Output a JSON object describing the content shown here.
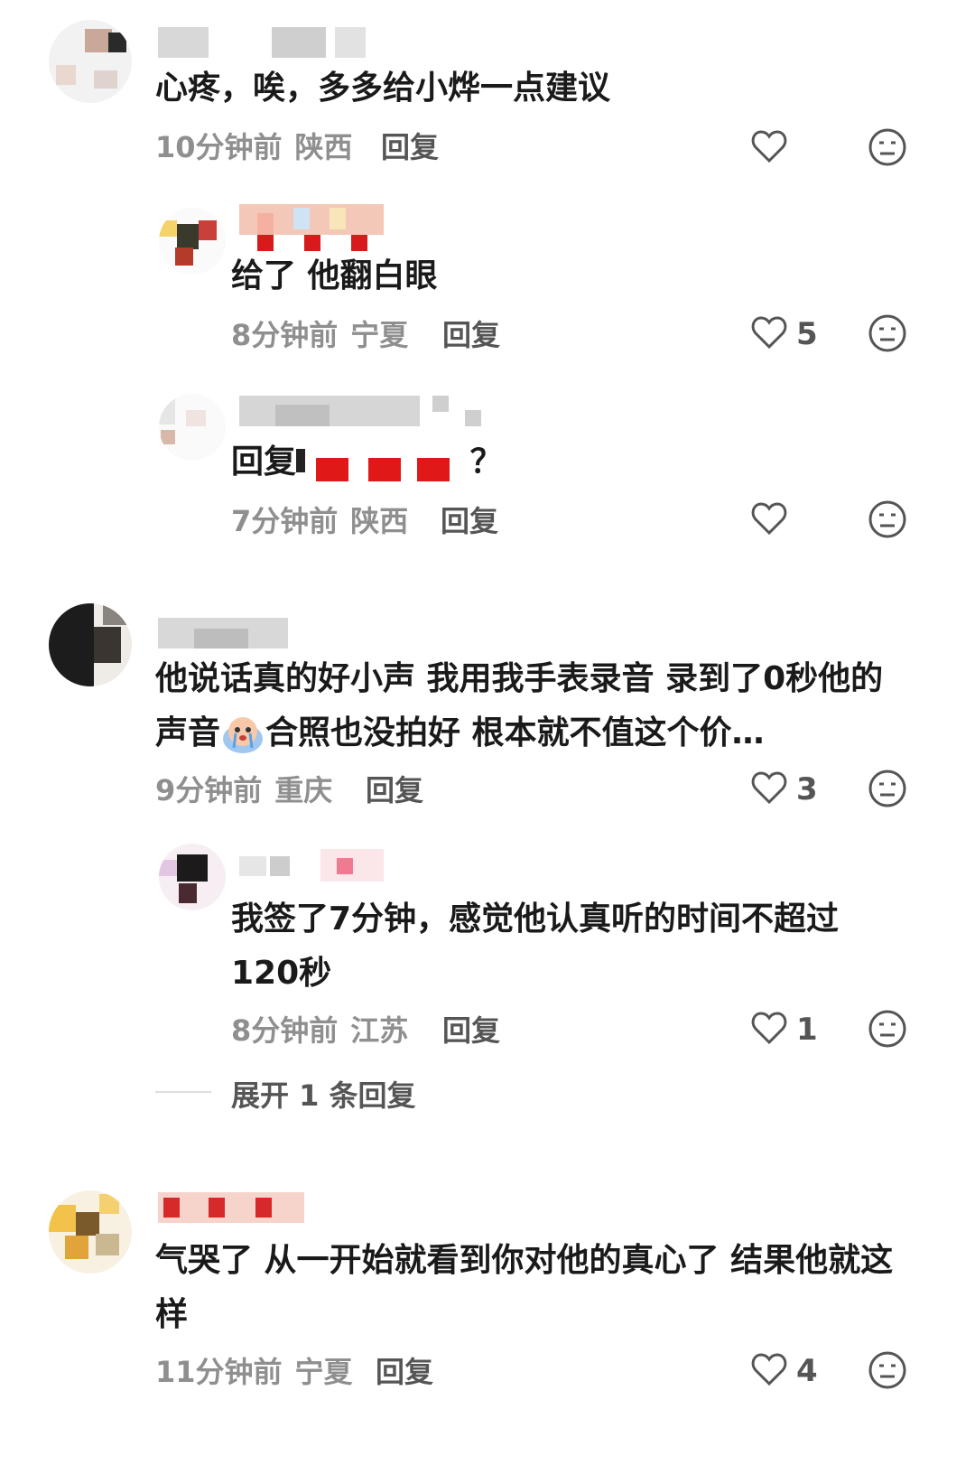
{
  "comments": [
    {
      "text": "心疼，唉，多多给小烨一点建议",
      "time": "10分钟前",
      "location": "陕西",
      "reply_label": "回复",
      "likes": ""
    },
    {
      "text": "给了 他翻白眼",
      "time": "8分钟前",
      "location": "宁夏",
      "reply_label": "回复",
      "likes": "5"
    },
    {
      "text_prefix": "回复",
      "text_suffix": "？",
      "time": "7分钟前",
      "location": "陕西",
      "reply_label": "回复",
      "likes": ""
    },
    {
      "text_part1": "他说话真的好小声 我用我手表录音 录到了0秒他的",
      "text_part2": "声音",
      "text_part3": "合照也没拍好 根本就不值这个价…",
      "emoji": "crying-face",
      "time": "9分钟前",
      "location": "重庆",
      "reply_label": "回复",
      "likes": "3"
    },
    {
      "text": "我签了7分钟，感觉他认真听的时间不超过120秒",
      "time": "8分钟前",
      "location": "江苏",
      "reply_label": "回复",
      "likes": "1"
    },
    {
      "text": "气哭了 从一开始就看到你对他的真心了 结果他就这样",
      "time": "11分钟前",
      "location": "宁夏",
      "reply_label": "回复",
      "likes": "4"
    }
  ],
  "expand_replies": "展开 1 条回复",
  "icons": {
    "like": "heart-outline-icon",
    "dislike": "neutral-face-icon"
  },
  "colors": {
    "meta": "#8f8f8f",
    "text": "#1a1a1a",
    "icon": "#555555"
  }
}
